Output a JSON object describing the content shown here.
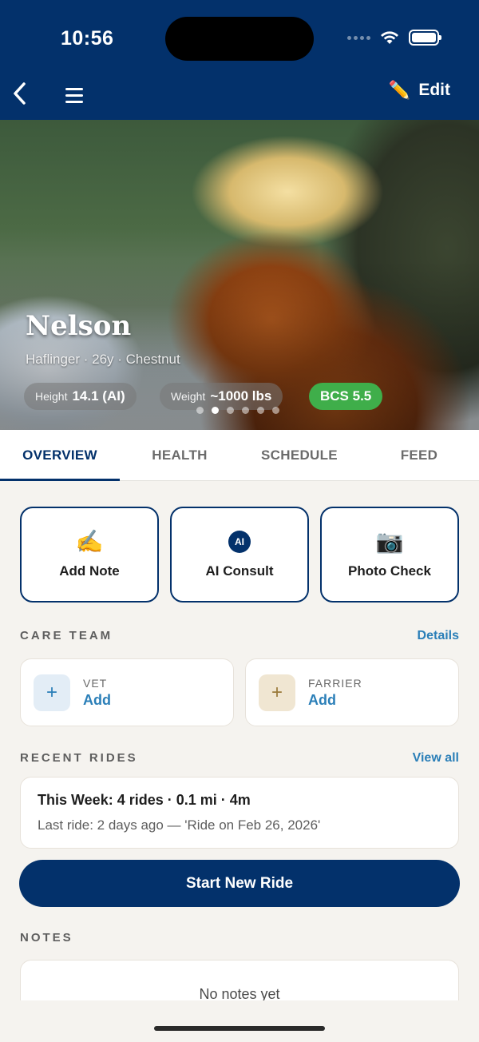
{
  "status_bar": {
    "time": "10:56"
  },
  "header": {
    "edit_label": "Edit"
  },
  "horse": {
    "name": "Nelson",
    "subtitle": "Haflinger · 26y · Chestnut",
    "height_label": "Height",
    "height_value": "14.1 (AI)",
    "weight_label": "Weight",
    "weight_value": "~1000 lbs",
    "bcs": "BCS 5.5",
    "carousel_active_index": 1,
    "carousel_count": 6
  },
  "tabs": [
    {
      "label": "OVERVIEW",
      "active": true
    },
    {
      "label": "HEALTH",
      "active": false
    },
    {
      "label": "SCHEDULE",
      "active": false
    },
    {
      "label": "FEED",
      "active": false
    }
  ],
  "actions": [
    {
      "label": "Add Note",
      "icon": "writing-hand-icon",
      "glyph": "✍️"
    },
    {
      "label": "AI Consult",
      "icon": "ai-horse-icon",
      "glyph": "AI"
    },
    {
      "label": "Photo Check",
      "icon": "camera-icon",
      "glyph": "📷"
    }
  ],
  "care_team": {
    "title": "CARE TEAM",
    "link": "Details",
    "members": [
      {
        "role": "VET",
        "action": "Add"
      },
      {
        "role": "FARRIER",
        "action": "Add"
      }
    ]
  },
  "recent_rides": {
    "title": "RECENT RIDES",
    "link": "View all",
    "summary": "This Week: 4 rides · 0.1 mi · 4m",
    "last_ride": "Last ride: 2 days ago — 'Ride on Feb 26, 2026'",
    "start_button": "Start New Ride"
  },
  "notes": {
    "title": "NOTES",
    "empty": "No notes yet"
  },
  "colors": {
    "brand_navy": "#03316b",
    "link_blue": "#2b7fb8",
    "bcs_green": "#3fae4a"
  }
}
